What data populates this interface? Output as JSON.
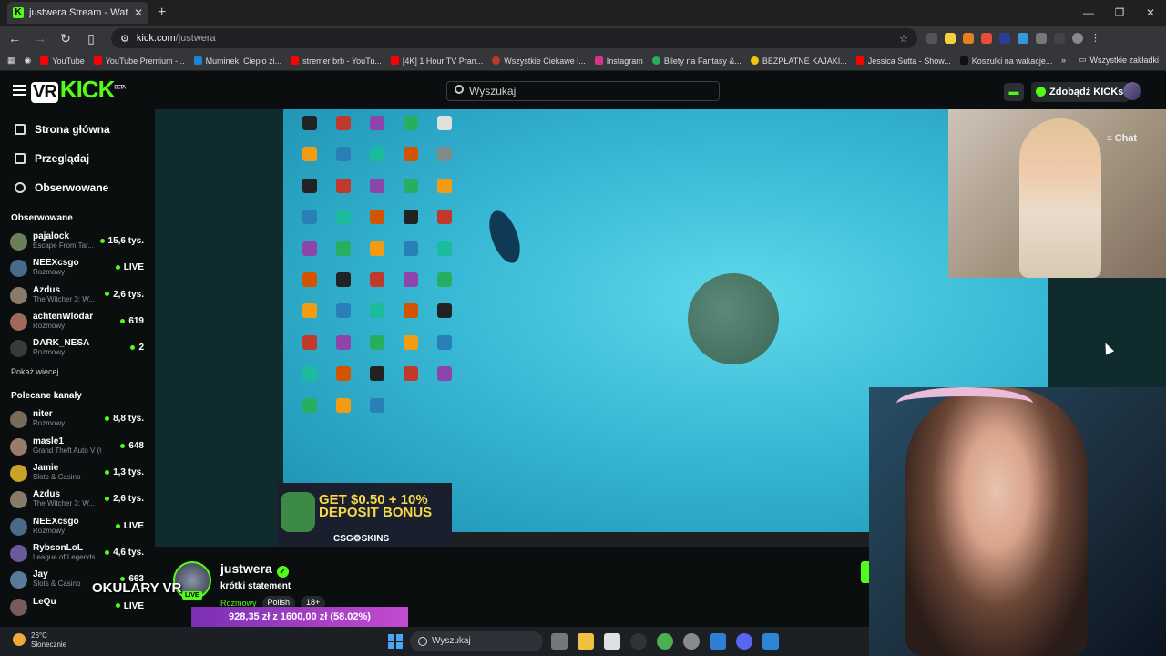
{
  "browser": {
    "tab_title": "justwera Stream - Watch Li",
    "url_domain": "kick.com",
    "url_path": "/justwera",
    "bookmarks": [
      "YouTube",
      "YouTube Premium -...",
      "Muminek: Ciepło zi...",
      "stremer brb - YouTu...",
      "[4K] 1 Hour TV Pran...",
      "Wszystkie Ciekawe i...",
      "Instagram",
      "Bilety na Fantasy &...",
      "BEZPŁATNE KAJAKI...",
      "Jessica Sutta - Show...",
      "Koszulki na wakacje..."
    ],
    "all_bookmarks": "Wszystkie zakładki"
  },
  "header": {
    "logo": "KICK",
    "logo_badge": "BETA",
    "search_placeholder": "Wyszukaj",
    "kicks_button": "Zdobądź KICKs"
  },
  "sidebar": {
    "nav": [
      {
        "label": "Strona główna",
        "icon": "home-icon"
      },
      {
        "label": "Przeglądaj",
        "icon": "browse-icon"
      },
      {
        "label": "Obserwowane",
        "icon": "heart-icon"
      }
    ],
    "followed_title": "Obserwowane",
    "followed": [
      {
        "name": "pajalock",
        "category": "Escape From Tar...",
        "viewers": "15,6 tys.",
        "color": "#6b7f5a"
      },
      {
        "name": "NEEXcsgo",
        "category": "Rozmowy",
        "viewers": "LIVE",
        "color": "#4a6a8a"
      },
      {
        "name": "Azdus",
        "category": "The Witcher 3: W...",
        "viewers": "2,6 tys.",
        "color": "#8a7a6a"
      },
      {
        "name": "achtenWlodar",
        "category": "Rozmowy",
        "viewers": "619",
        "color": "#a06a5a"
      },
      {
        "name": "DARK_NESA",
        "category": "Rozmowy",
        "viewers": "2",
        "color": "#3a3a3a"
      }
    ],
    "show_more": "Pokaż więcej",
    "recommended_title": "Polecane kanały",
    "recommended": [
      {
        "name": "niter",
        "category": "Rozmowy",
        "viewers": "8,8 tys.",
        "color": "#7a6a5a"
      },
      {
        "name": "masle1",
        "category": "Grand Theft Auto V (G...",
        "viewers": "648",
        "color": "#9a7a6a"
      },
      {
        "name": "Jamie",
        "category": "Slots & Casino",
        "viewers": "1,3 tys.",
        "color": "#c9a227"
      },
      {
        "name": "Azdus",
        "category": "The Witcher 3: W...",
        "viewers": "2,6 tys.",
        "color": "#8a7a6a"
      },
      {
        "name": "NEEXcsgo",
        "category": "Rozmowy",
        "viewers": "LIVE",
        "color": "#4a6a8a"
      },
      {
        "name": "RybsonLoL",
        "category": "League of Legends",
        "viewers": "4,6 tys.",
        "color": "#6a5a9a"
      },
      {
        "name": "Jay",
        "category": "Slots & Casino",
        "viewers": "663",
        "color": "#5a7a9a"
      },
      {
        "name": "LeQu",
        "category": "",
        "viewers": "LIVE",
        "color": "#7a5a5a"
      }
    ]
  },
  "video": {
    "chat_button": "Chat",
    "ad_line1": "GET $0.50 + 10%",
    "ad_line2": "DEPOSIT BONUS",
    "ad_brand": "CSG⚙SKINS"
  },
  "stream": {
    "streamer": "justwera",
    "live_badge": "LIVE",
    "title": "krótki statement",
    "category": "Rozmowy",
    "tags": [
      "Polish",
      "18+"
    ],
    "overlay_text": "OKULARY VR",
    "goal_text": "928,35 zł  z  1600,00 zł  (58.02%)"
  },
  "taskbar": {
    "temperature": "26°C",
    "weather": "Słonecznie",
    "search_placeholder": "Wyszukaj"
  }
}
